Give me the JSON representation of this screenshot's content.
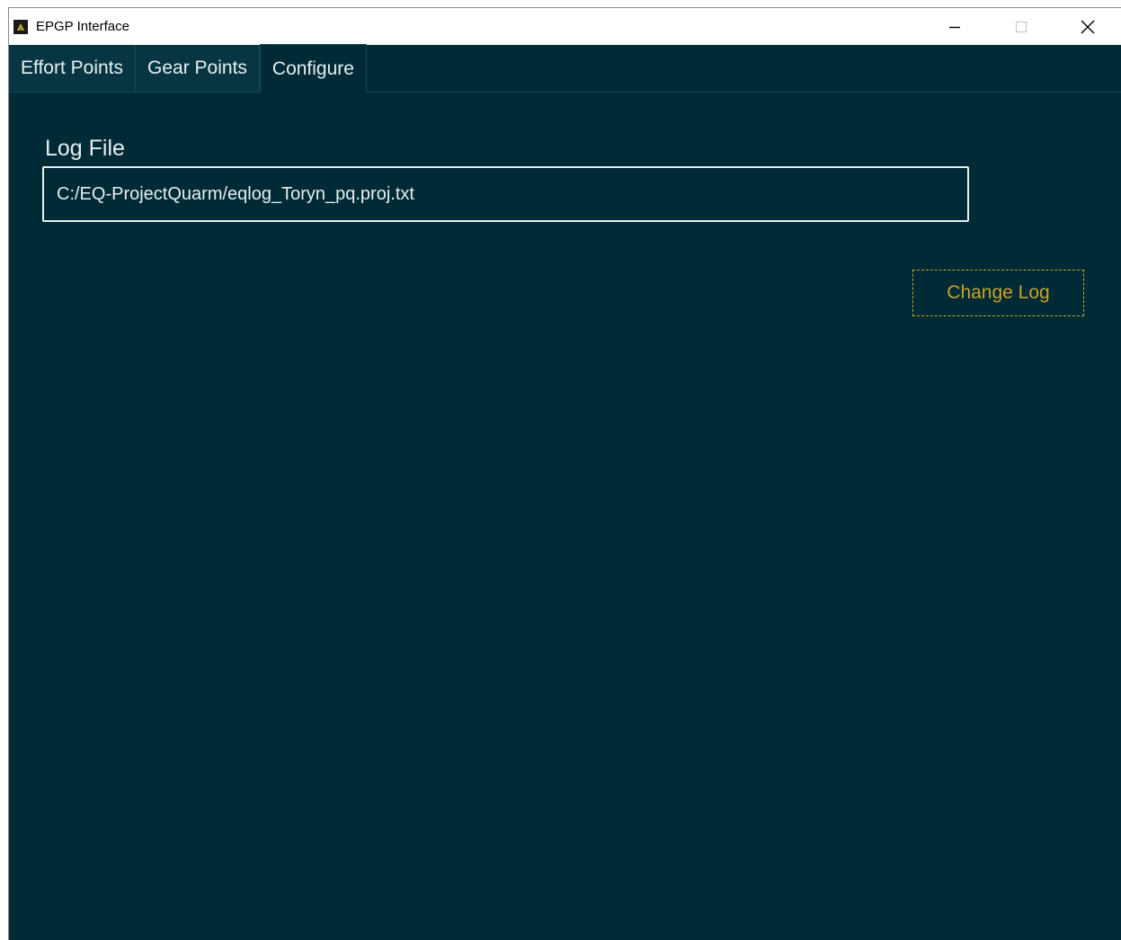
{
  "window": {
    "title": "EPGP Interface"
  },
  "tabs": [
    {
      "label": "Effort Points",
      "active": false
    },
    {
      "label": "Gear Points",
      "active": false
    },
    {
      "label": "Configure",
      "active": true
    }
  ],
  "configure": {
    "log_label": "Log File",
    "log_path": "C:/EQ-ProjectQuarm/eqlog_Toryn_pq.proj.txt",
    "change_button": "Change Log"
  },
  "colors": {
    "background": "#002b36",
    "text": "#e6eef0",
    "accent": "#c9a227"
  },
  "icons": {
    "app": "app-logo-icon",
    "minimize": "minimize-icon",
    "maximize": "maximize-icon",
    "close": "close-icon"
  }
}
